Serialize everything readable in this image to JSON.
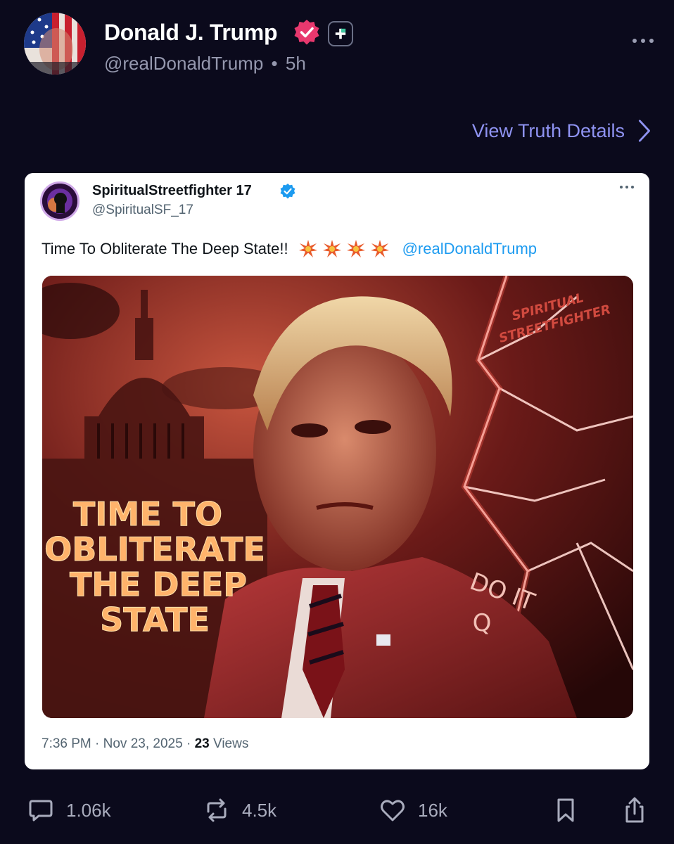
{
  "post": {
    "display_name": "Donald J. Trump",
    "handle": "@realDonaldTrump",
    "separator": "•",
    "time": "5h",
    "view_details_label": "View Truth Details"
  },
  "embedded": {
    "name": "SpiritualStreetfighter 17",
    "handle": "@SpiritualSF_17",
    "text": "Time To Obliterate The Deep State!!",
    "mention": "@realDonaldTrump",
    "image_text": {
      "line1": "TIME TO",
      "line2": "OBLITERATE",
      "line3": "THE DEEP",
      "line4": "STATE",
      "suit_text1": "DO IT",
      "suit_text2": "Q",
      "watermark1": "SPIRITUAL",
      "watermark2": "STREETFIGHTER"
    },
    "timestamp": "7:36 PM · Nov 23, 2025 ·",
    "views_count": "23",
    "views_label": "Views"
  },
  "actions": {
    "replies": "1.06k",
    "retruths": "4.5k",
    "likes": "16k"
  },
  "colors": {
    "background": "#0b0a1c",
    "link": "#8f93f2",
    "verified": "#e8386e",
    "card_verified": "#1d9bf0",
    "muted": "#9598ae"
  },
  "icons": [
    "verified-icon",
    "plus-icon",
    "more-icon",
    "chevron-right-icon",
    "reply-icon",
    "retruth-icon",
    "like-icon",
    "bookmark-icon",
    "share-icon"
  ]
}
